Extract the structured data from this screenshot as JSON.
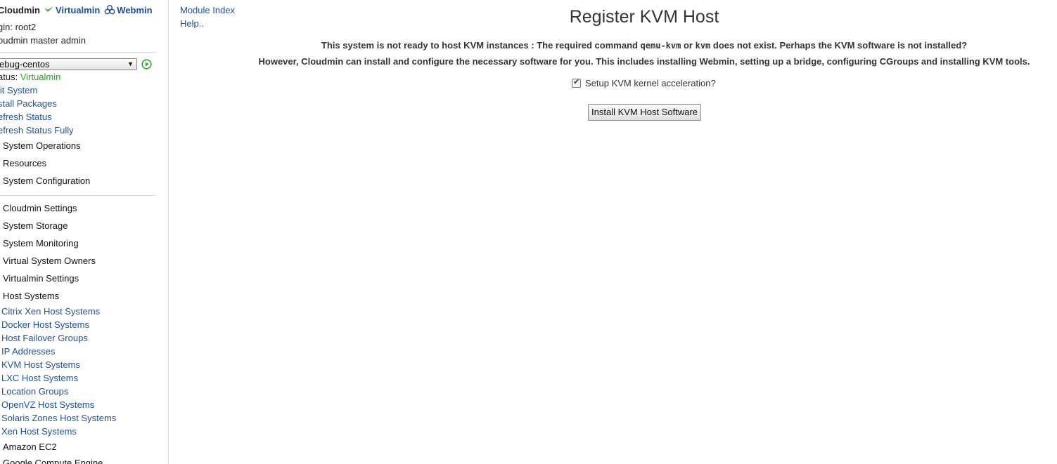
{
  "sidebar": {
    "products": {
      "cloudmin": "Cloudmin",
      "virtualmin": "Virtualmin",
      "webmin": "Webmin"
    },
    "login_text": "gin: root2",
    "role_text": "oudmin master admin",
    "server_select_value": "ebug-centos",
    "status_label": "atus:",
    "status_value": "Virtualmin",
    "system_links": [
      "lit System",
      "stall Packages",
      "efresh Status",
      "efresh Status Fully"
    ],
    "system_categories": [
      "System Operations",
      "Resources",
      "System Configuration"
    ],
    "global_categories_before": [
      "Cloudmin Settings",
      "System Storage",
      "System Monitoring",
      "Virtual System Owners",
      "Virtualmin Settings",
      "Host Systems"
    ],
    "host_systems_items": [
      "Citrix Xen Host Systems",
      "Docker Host Systems",
      "Host Failover Groups",
      "IP Addresses",
      "KVM Host Systems",
      "LXC Host Systems",
      "Location Groups",
      "OpenVZ Host Systems",
      "Solaris Zones Host Systems",
      "Xen Host Systems"
    ],
    "global_categories_after": [
      "Amazon EC2",
      "Google Compute Engine"
    ],
    "colors": {
      "link": "#1f4f99",
      "status_value": "#2a9d2a",
      "go_button": "#2ea82e"
    },
    "icons": {
      "virtualmin": "check-swoosh-icon",
      "webmin": "webmin-logo-icon",
      "go": "play-circle-icon",
      "dropdown": "dropdown-arrow-icon"
    }
  },
  "main": {
    "module_index_link": "Module Index",
    "help_link": "Help..",
    "title": "Register KVM Host",
    "message1": {
      "part1": "This system is not ready to host KVM instances : The required command ",
      "cmd1": "qemu-kvm",
      "part2": " or ",
      "cmd2": "kvm",
      "part3": " does not exist. Perhaps the KVM software is not installed?"
    },
    "message2": "However, Cloudmin can install and configure the necessary software for you. This includes installing Webmin, setting up a bridge, configuring CGroups and installing KVM tools.",
    "accel_checkbox_label": "Setup KVM kernel acceleration?",
    "accel_checked": true,
    "install_button_label": "Install KVM Host Software"
  }
}
